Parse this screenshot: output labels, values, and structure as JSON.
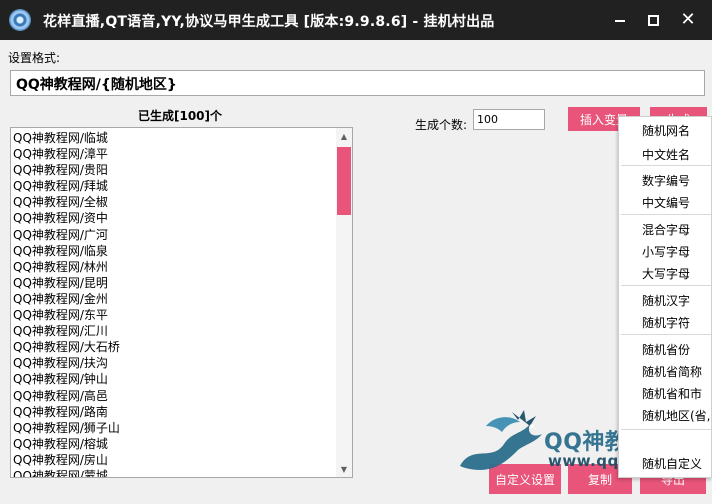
{
  "window": {
    "title": "花样直播,QT语音,YY,协议马甲生成工具 [版本:9.9.8.6] - 挂机村出品",
    "minimize_icon": "minimize-icon",
    "maximize_icon": "maximize-icon",
    "close_icon": "close-icon",
    "close_glyph": "✕"
  },
  "format": {
    "label": "设置格式:",
    "value": "QQ神教程网/{随机地区}"
  },
  "generated": {
    "title": "已生成[100]个",
    "items": [
      "QQ神教程网/临城",
      "QQ神教程网/漳平",
      "QQ神教程网/贵阳",
      "QQ神教程网/拜城",
      "QQ神教程网/全椒",
      "QQ神教程网/资中",
      "QQ神教程网/广河",
      "QQ神教程网/临泉",
      "QQ神教程网/林州",
      "QQ神教程网/昆明",
      "QQ神教程网/金州",
      "QQ神教程网/东平",
      "QQ神教程网/汇川",
      "QQ神教程网/大石桥",
      "QQ神教程网/扶沟",
      "QQ神教程网/钟山",
      "QQ神教程网/高邑",
      "QQ神教程网/路南",
      "QQ神教程网/狮子山",
      "QQ神教程网/榕城",
      "QQ神教程网/房山",
      "QQ神教程网/蒙城"
    ]
  },
  "count": {
    "label": "生成个数:",
    "value": "100"
  },
  "buttons": {
    "insert_variable": "插入变量",
    "generate": "生成",
    "custom_settings": "自定义设置",
    "copy": "复制",
    "export": "导出"
  },
  "variable_menu": [
    "随机网名",
    "中文姓名",
    "数字编号",
    "中文编号",
    "混合字母",
    "小写字母",
    "大写字母",
    "随机汉字",
    "随机字符",
    "随机省份",
    "随机省简称",
    "随机省和市",
    "随机地区(省,市)",
    "随机自定义"
  ],
  "watermark": {
    "line1": "QQ神教程网",
    "line2": "www.qqshen.com"
  },
  "colors": {
    "accent": "#e8547a",
    "titlebar": "#212121",
    "background": "#f0f0f0"
  }
}
